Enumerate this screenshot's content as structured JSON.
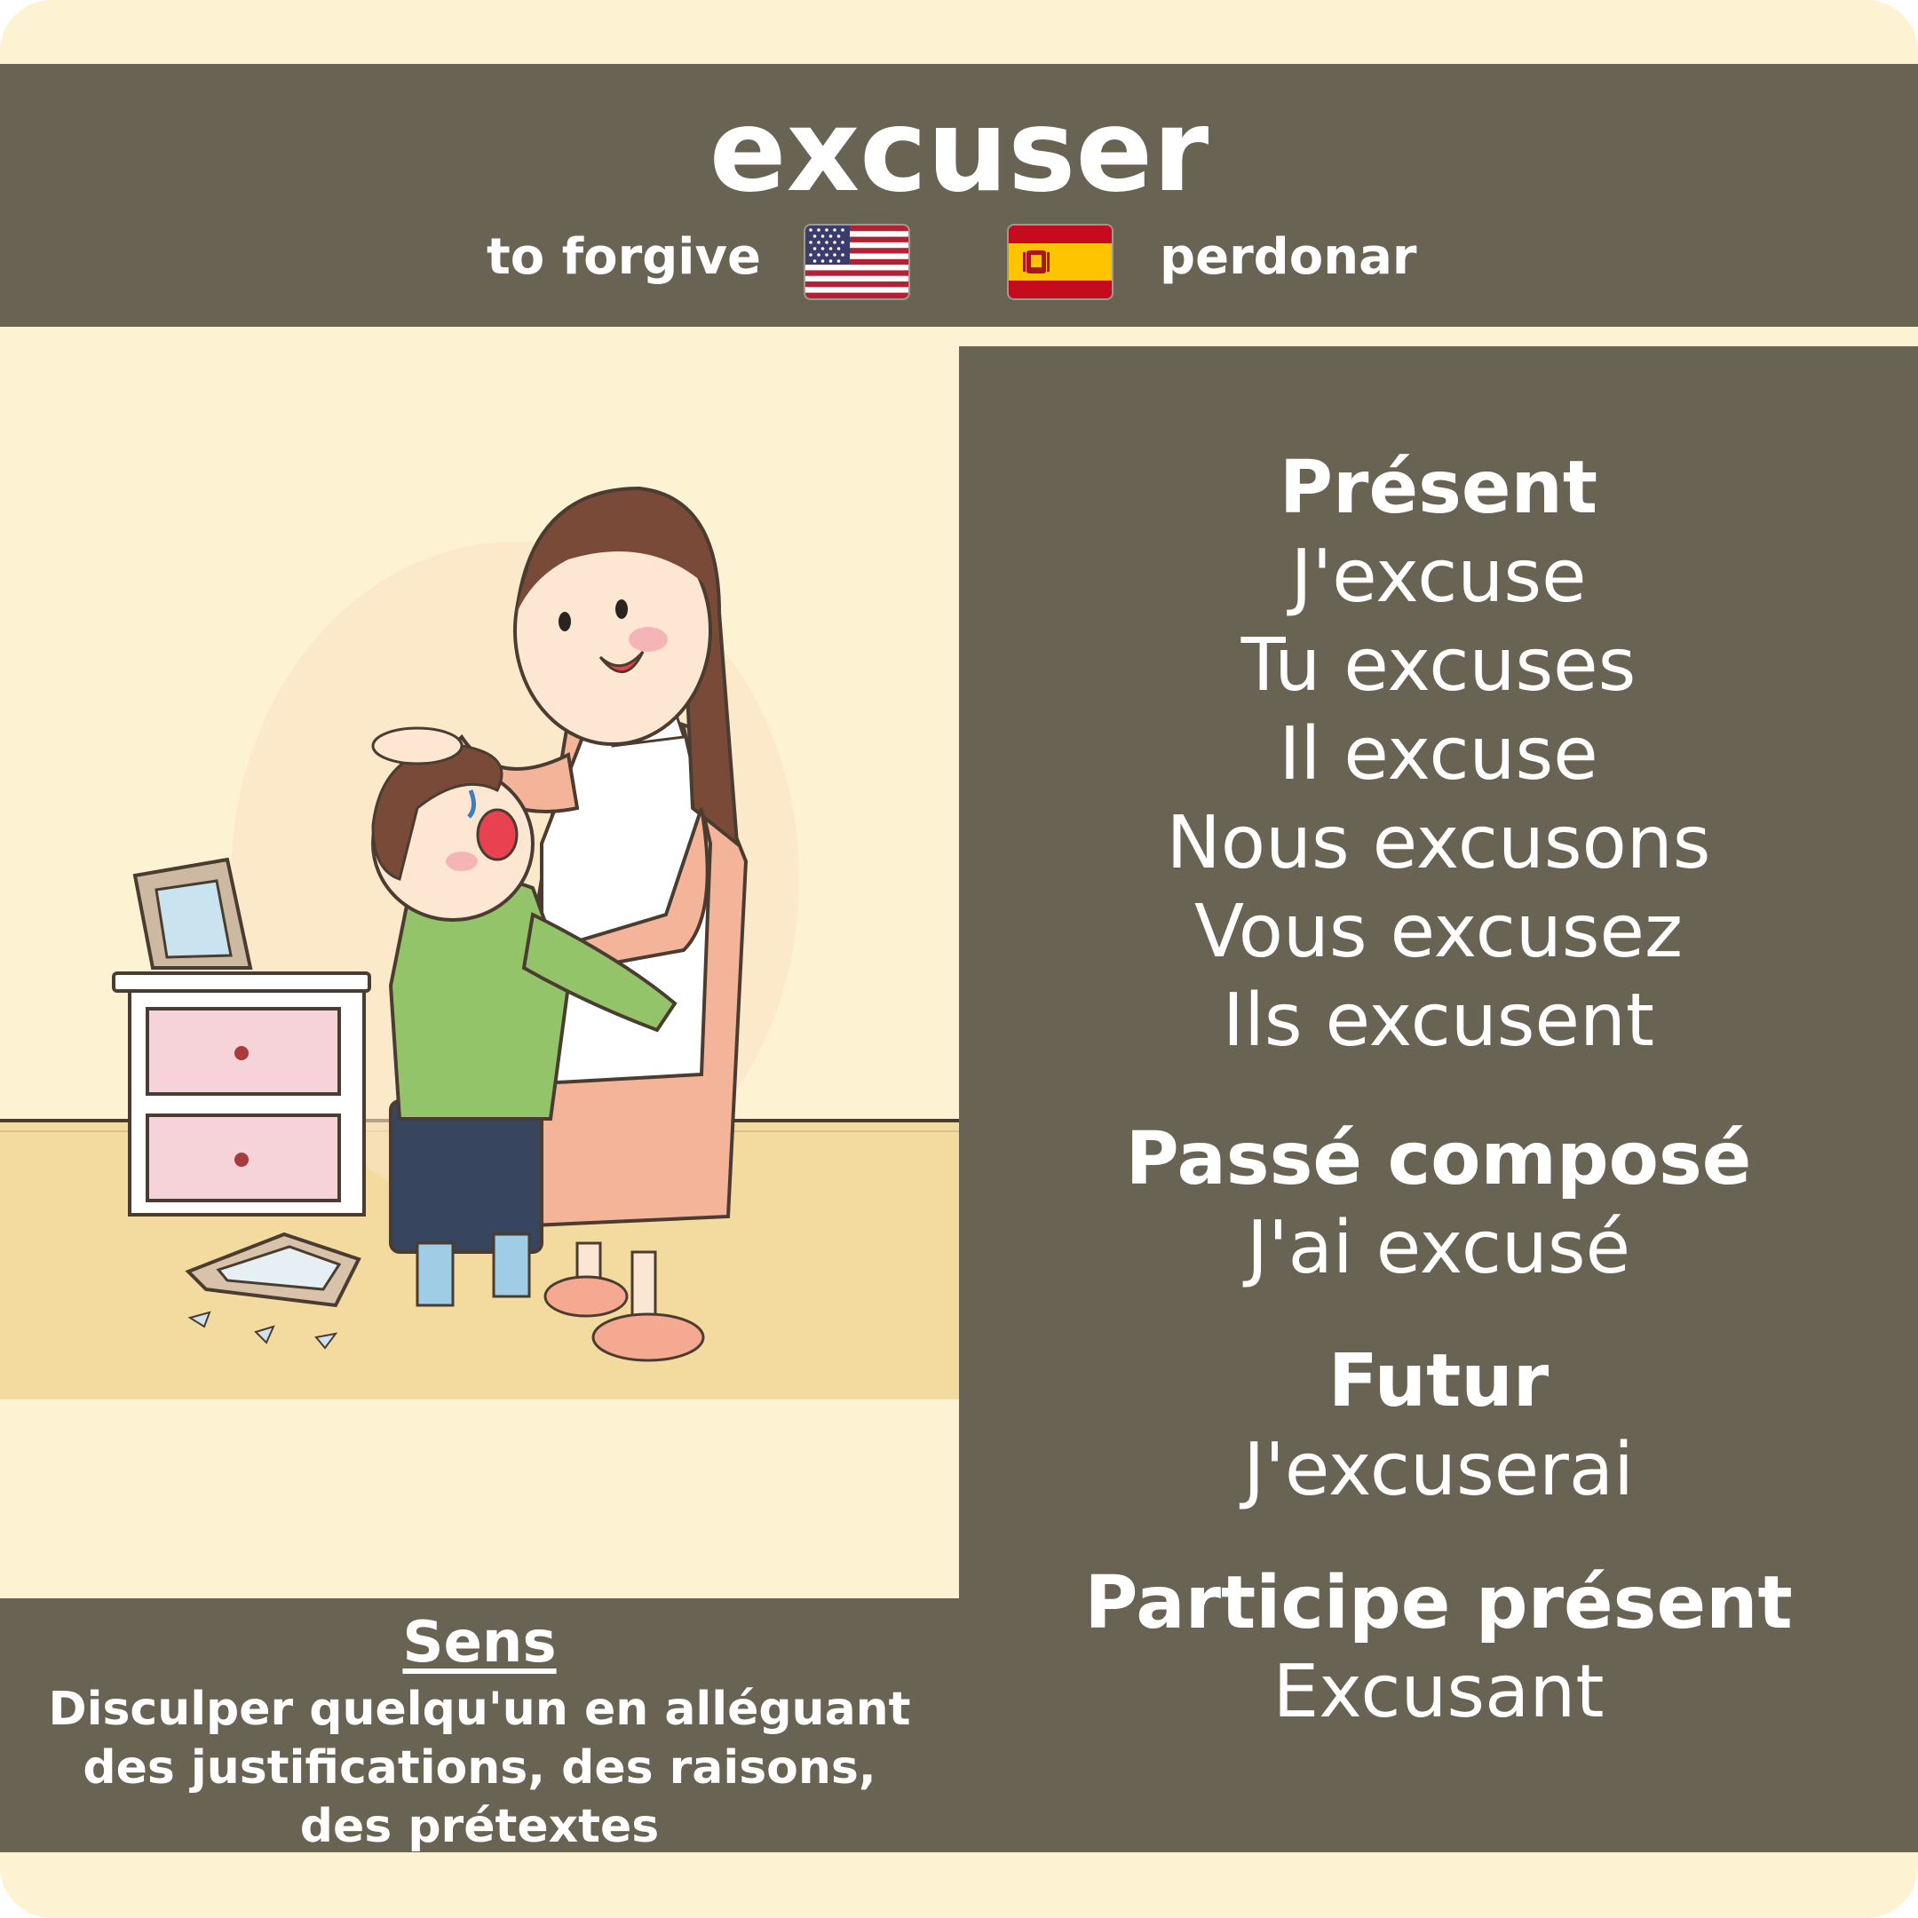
{
  "verb": "excuser",
  "translations": {
    "english": "to forgive",
    "english_flag": "us-flag-icon",
    "spanish": "perdonar",
    "spanish_flag": "spain-flag-icon"
  },
  "colors": {
    "background": "#fdf2d2",
    "panel": "#696353",
    "text": "#ffffff"
  },
  "illustration": "mother-hugging-crying-boy-near-broken-picture-frame",
  "conjugations": {
    "present": {
      "heading": "Présent",
      "forms": [
        "J'excuse",
        "Tu excuses",
        "Il excuse",
        "Nous excusons",
        "Vous excusez",
        "Ils excusent"
      ]
    },
    "passe_compose": {
      "heading": "Passé composé",
      "form": "J'ai excusé"
    },
    "futur": {
      "heading": "Futur",
      "form": "J'excuserai"
    },
    "participe_present": {
      "heading": "Participe présent",
      "form": "Excusant"
    }
  },
  "sense": {
    "heading": "Sens",
    "lines": [
      "Disculper quelqu'un en alléguant",
      "des justifications, des raisons,",
      "des prétextes"
    ]
  }
}
